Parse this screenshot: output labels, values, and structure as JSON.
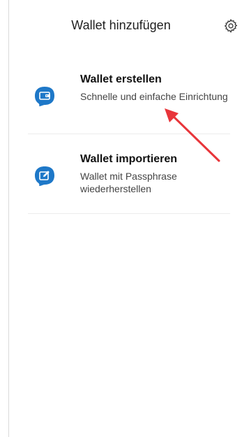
{
  "header": {
    "title": "Wallet hinzufügen",
    "settings_icon": "gear-icon"
  },
  "options": [
    {
      "title": "Wallet erstellen",
      "subtitle": "Schnelle und einfache Einrichtung",
      "icon": "wallet-icon"
    },
    {
      "title": "Wallet importieren",
      "subtitle": "Wallet mit Passphrase wiederherstellen",
      "icon": "edit-icon"
    }
  ],
  "colors": {
    "accent": "#1e78c8",
    "annotation_arrow": "#e8353a"
  }
}
